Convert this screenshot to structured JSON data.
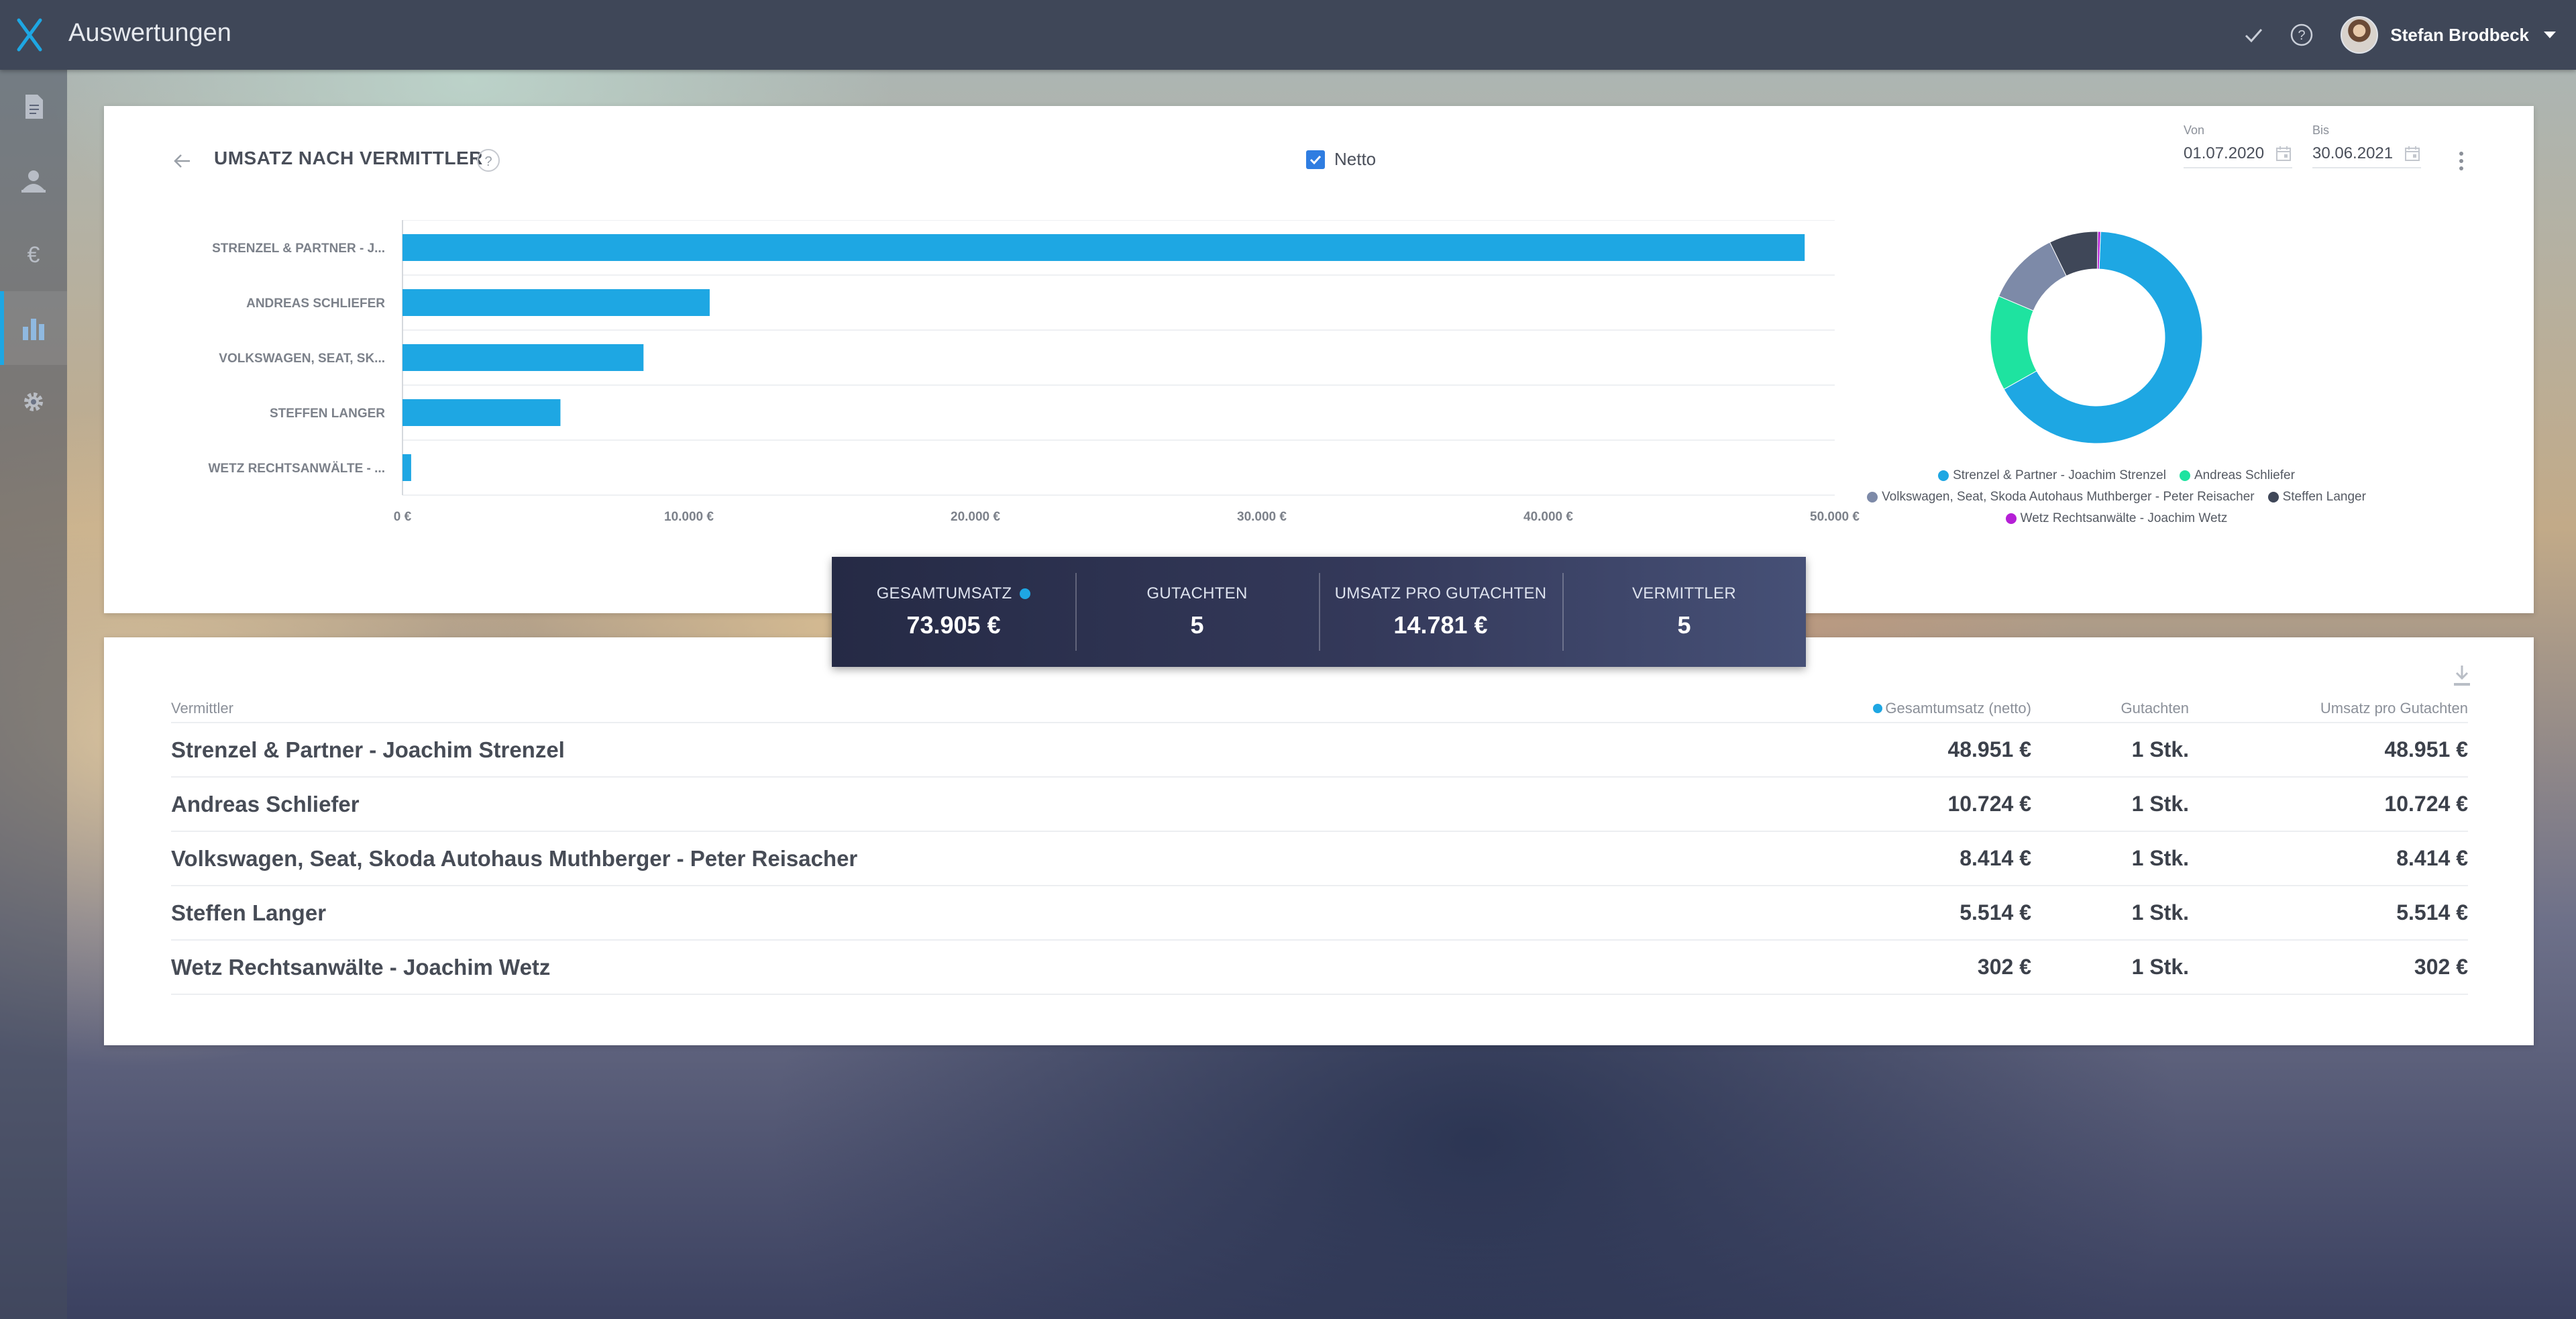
{
  "app": {
    "title": "Auswertungen",
    "user_name": "Stefan Brodbeck"
  },
  "sidebar": {
    "items": [
      {
        "icon": "document-icon"
      },
      {
        "icon": "user-card-icon"
      },
      {
        "icon": "euro-icon"
      },
      {
        "icon": "bar-chart-icon",
        "active": true
      },
      {
        "icon": "gear-icon"
      }
    ]
  },
  "chart_card": {
    "title": "UMSATZ NACH VERMITTLER",
    "help": "?",
    "netto_label": "Netto",
    "netto_checked": true,
    "von_label": "Von",
    "von_value": "01.07.2020",
    "bis_label": "Bis",
    "bis_value": "30.06.2021"
  },
  "chart_data": [
    {
      "type": "bar",
      "orientation": "horizontal",
      "categories": [
        "STRENZEL & PARTNER - J...",
        "ANDREAS SCHLIEFER",
        "VOLKSWAGEN, SEAT, SK...",
        "STEFFEN LANGER",
        "WETZ RECHTSANWÄLTE - ..."
      ],
      "values": [
        48951,
        10724,
        8414,
        5514,
        302
      ],
      "xticks": [
        "0 €",
        "10.000 €",
        "20.000 €",
        "30.000 €",
        "40.000 €",
        "50.000 €"
      ],
      "xlim": [
        0,
        50000
      ],
      "color": "#1ea7e3",
      "grid": true
    },
    {
      "type": "pie",
      "donut": true,
      "labels": [
        "Strenzel & Partner - Joachim Strenzel",
        "Andreas Schliefer",
        "Volkswagen, Seat, Skoda Autohaus Muthberger - Peter Reisacher",
        "Steffen Langer",
        "Wetz Rechtsanwälte - Joachim Wetz"
      ],
      "values": [
        48951,
        10724,
        8414,
        5514,
        302
      ],
      "colors": [
        "#1ea7e3",
        "#1ee3a0",
        "#7d8aa8",
        "#3f4758",
        "#b51fd6"
      ],
      "legend_placement": "bottom"
    }
  ],
  "summary": [
    {
      "label": "GESAMTUMSATZ",
      "value": "73.905 €",
      "dot": true
    },
    {
      "label": "GUTACHTEN",
      "value": "5"
    },
    {
      "label": "UMSATZ PRO GUTACHTEN",
      "value": "14.781 €"
    },
    {
      "label": "VERMITTLER",
      "value": "5"
    }
  ],
  "table": {
    "headers": [
      "Vermittler",
      "Gesamtumsatz (netto)",
      "Gutachten",
      "Umsatz pro Gutachten"
    ],
    "rows": [
      {
        "name": "Strenzel & Partner - Joachim Strenzel",
        "umsatz": "48.951 €",
        "gutachten": "1 Stk.",
        "pro": "48.951 €"
      },
      {
        "name": "Andreas Schliefer",
        "umsatz": "10.724 €",
        "gutachten": "1 Stk.",
        "pro": "10.724 €"
      },
      {
        "name": "Volkswagen, Seat, Skoda Autohaus Muthberger - Peter Reisacher",
        "umsatz": "8.414 €",
        "gutachten": "1 Stk.",
        "pro": "8.414 €"
      },
      {
        "name": "Steffen Langer",
        "umsatz": "5.514 €",
        "gutachten": "1 Stk.",
        "pro": "5.514 €"
      },
      {
        "name": "Wetz Rechtsanwälte - Joachim Wetz",
        "umsatz": "302 €",
        "gutachten": "1 Stk.",
        "pro": "302 €"
      }
    ]
  }
}
